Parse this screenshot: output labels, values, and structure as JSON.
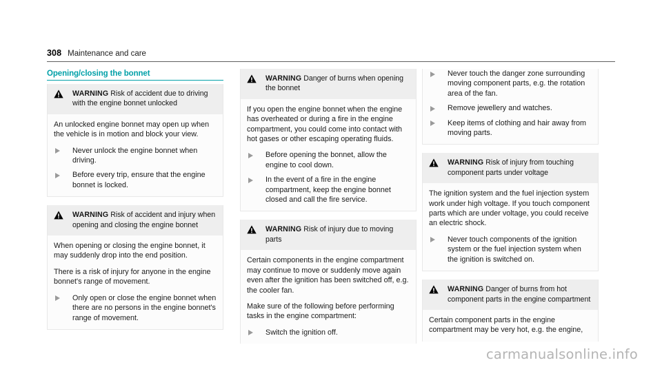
{
  "header": {
    "page_number": "308",
    "title": "Maintenance and care"
  },
  "section": {
    "heading": "Opening/closing the bonnet"
  },
  "watermark": "carmanualsonline.info",
  "labels": {
    "warning_keyword": "WARNING"
  },
  "columns": [
    {
      "id": "column-left",
      "boxes": [
        {
          "id": "warning-driving-bonnet-unlocked",
          "has_head": true,
          "head_keyword": "WARNING",
          "head_text": "Risk of accident due to driving with the engine bonnet unlocked",
          "paragraphs": [
            "An unlocked engine bonnet may open up when the vehicle is in motion and block your view."
          ],
          "steps": [
            "Never unlock the engine bonnet when driving.",
            "Before every trip, ensure that the engine bonnet is locked."
          ]
        },
        {
          "id": "warning-opening-closing-bonnet",
          "has_head": true,
          "head_keyword": "WARNING",
          "head_text": "Risk of accident and injury when opening and closing the engine bonnet",
          "paragraphs": [
            "When opening or closing the engine bonnet, it may suddenly drop into the end position.",
            "There is a risk of injury for anyone in the engine bonnet's range of movement."
          ],
          "steps": [
            "Only open or close the engine bonnet when there are no persons in the engine bonnet's range of movement."
          ]
        }
      ]
    },
    {
      "id": "column-middle",
      "boxes": [
        {
          "id": "warning-burns-opening-bonnet",
          "has_head": true,
          "head_keyword": "WARNING",
          "head_text": "Danger of burns when opening the bonnet",
          "paragraphs": [
            "If you open the engine bonnet when the engine has overheated or during a fire in the engine compartment, you could come into contact with hot gases or other escaping operating fluids."
          ],
          "steps": [
            "Before opening the bonnet, allow the engine to cool down.",
            "In the event of a fire in the engine compartment, keep the engine bonnet closed and call the fire service."
          ]
        },
        {
          "id": "warning-moving-parts",
          "has_head": true,
          "head_keyword": "WARNING",
          "head_text": "Risk of injury due to moving parts",
          "paragraphs": [
            "Certain components in the engine compartment may continue to move or suddenly move again even after the ignition has been switched off, e.g. the cooler fan.",
            "Make sure of the following before performing tasks in the engine compartment:"
          ],
          "steps": [
            "Switch the ignition off."
          ],
          "clipped": true
        }
      ]
    },
    {
      "id": "column-right",
      "boxes": [
        {
          "id": "warning-moving-parts-continued",
          "has_head": false,
          "paragraphs": [],
          "steps": [
            "Never touch the danger zone surrounding moving component parts, e.g. the rotation area of the fan.",
            "Remove jewellery and watches.",
            "Keep items of clothing and hair away from moving parts."
          ]
        },
        {
          "id": "warning-component-parts-under-voltage",
          "has_head": true,
          "head_keyword": "WARNING",
          "head_text": "Risk of injury from touching component parts under voltage",
          "paragraphs": [
            "The ignition system and the fuel injection system work under high voltage. If you touch component parts which are under voltage, you could receive an electric shock."
          ],
          "steps": [
            "Never touch components of the ignition system or the fuel injection system when the ignition is switched on."
          ]
        },
        {
          "id": "warning-burns-hot-component-parts",
          "has_head": true,
          "head_keyword": "WARNING",
          "head_text": "Danger of burns from hot component parts in the engine compartment",
          "paragraphs": [
            "Certain component parts in the engine compartment may be very hot, e.g. the engine,"
          ],
          "steps": [],
          "clipped": true
        }
      ]
    }
  ]
}
